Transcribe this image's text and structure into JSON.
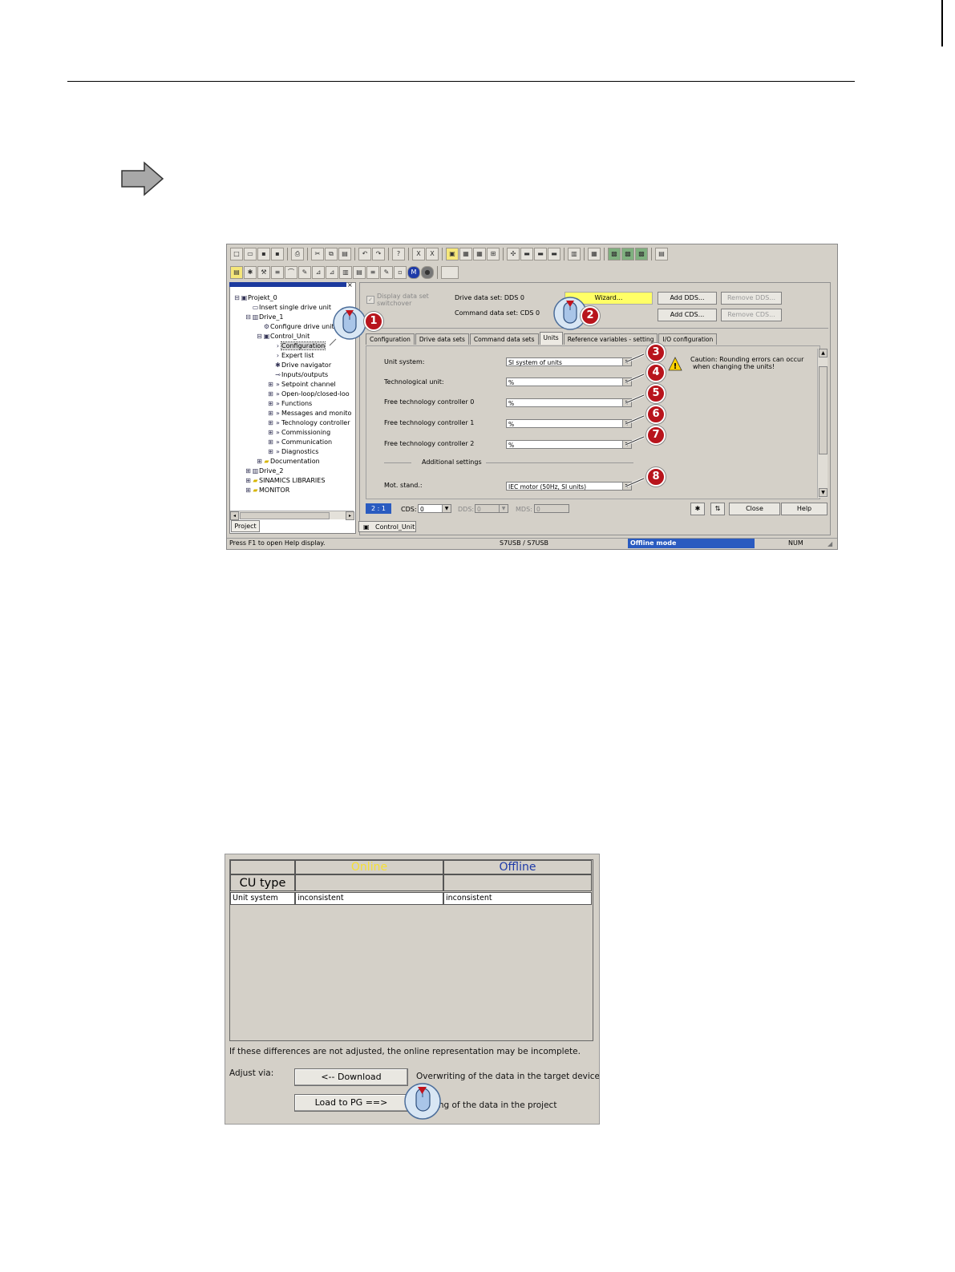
{
  "screenshot1": {
    "tree": {
      "items": [
        {
          "label": "Projekt_0",
          "indent": 0,
          "icon": "project-icon",
          "expander": "⊟"
        },
        {
          "label": "Insert single drive unit",
          "indent": 1,
          "icon": "insert-icon",
          "expander": ""
        },
        {
          "label": "Drive_1",
          "indent": 1,
          "icon": "drive-icon",
          "expander": "⊟"
        },
        {
          "label": "Configure drive unit",
          "indent": 2,
          "icon": "configure-icon",
          "expander": ""
        },
        {
          "label": "Control_Unit",
          "indent": 2,
          "icon": "control-unit-icon",
          "expander": "⊟"
        },
        {
          "label": "Configuration",
          "indent": 3,
          "icon": "arrow-icon",
          "expander": "",
          "selected": true
        },
        {
          "label": "Expert list",
          "indent": 3,
          "icon": "arrow-icon",
          "expander": ""
        },
        {
          "label": "Drive navigator",
          "indent": 3,
          "icon": "navigator-icon",
          "expander": ""
        },
        {
          "label": "Inputs/outputs",
          "indent": 3,
          "icon": "io-icon",
          "expander": ""
        },
        {
          "label": "Setpoint channel",
          "indent": 3,
          "icon": "double-arrow-icon",
          "expander": "⊞"
        },
        {
          "label": "Open-loop/closed-loo",
          "indent": 3,
          "icon": "double-arrow-icon",
          "expander": "⊞"
        },
        {
          "label": "Functions",
          "indent": 3,
          "icon": "double-arrow-icon",
          "expander": "⊞"
        },
        {
          "label": "Messages and monito",
          "indent": 3,
          "icon": "double-arrow-icon",
          "expander": "⊞"
        },
        {
          "label": "Technology controller",
          "indent": 3,
          "icon": "double-arrow-icon",
          "expander": "⊞"
        },
        {
          "label": "Commissioning",
          "indent": 3,
          "icon": "double-arrow-icon",
          "expander": "⊞"
        },
        {
          "label": "Communication",
          "indent": 3,
          "icon": "double-arrow-icon",
          "expander": "⊞"
        },
        {
          "label": "Diagnostics",
          "indent": 3,
          "icon": "double-arrow-icon",
          "expander": "⊞"
        },
        {
          "label": "Documentation",
          "indent": 2,
          "icon": "folder-icon",
          "expander": "⊞"
        },
        {
          "label": "Drive_2",
          "indent": 1,
          "icon": "drive-icon",
          "expander": "⊞"
        },
        {
          "label": "SINAMICS LIBRARIES",
          "indent": 1,
          "icon": "folder-icon",
          "expander": "⊞"
        },
        {
          "label": "MONITOR",
          "indent": 1,
          "icon": "folder-icon",
          "expander": "⊞"
        }
      ],
      "project_tab": "Project"
    },
    "header": {
      "display_dataset_label": "Display data set",
      "display_dataset_label2": "switchover",
      "drive_data_set": "Drive data set: DDS 0",
      "command_data_set": "Command data set: CDS 0",
      "wizard": "Wizard...",
      "add_dds": "Add DDS...",
      "remove_dds": "Remove DDS...",
      "add_cds": "Add CDS...",
      "remove_cds": "Remove CDS..."
    },
    "tabs": [
      "Configuration",
      "Drive data sets",
      "Command data sets",
      "Units",
      "Reference variables - setting",
      "I/O configuration"
    ],
    "form": {
      "unit_system": {
        "label": "Unit system:",
        "value": "SI system of units"
      },
      "technological_unit": {
        "label": "Technological unit:",
        "value": "%"
      },
      "ftc0": {
        "label": "Free technology controller 0",
        "value": "%"
      },
      "ftc1": {
        "label": "Free technology controller 1",
        "value": "%"
      },
      "ftc2": {
        "label": "Free technology controller 2",
        "value": "%"
      },
      "additional_settings": "Additional settings",
      "mot_stand": {
        "label": "Mot. stand.:",
        "value": "IEC motor (50Hz, SI units)"
      },
      "caution_line1": "Caution: Rounding errors can occur",
      "caution_line2": "when changing the units!"
    },
    "bottom": {
      "ratio": "2 : 1",
      "cds_label": "CDS:",
      "cds_value": "0",
      "dds_label": "DDS:",
      "dds_value": "0",
      "mds_label": "MDS:",
      "mds_value": "0",
      "close": "Close",
      "help": "Help",
      "doc_tab": "Control_Unit"
    },
    "status": {
      "help_text": "Press F1 to open Help display.",
      "connection": "S7USB / S7USB",
      "mode": "Offline mode",
      "num": "NUM"
    },
    "badges": [
      "1",
      "2",
      "3",
      "4",
      "5",
      "6",
      "7",
      "8"
    ],
    "colors": {
      "offline_bar": "#2a5bc0",
      "wizard": "#ffff66",
      "badge": "#b8141c"
    }
  },
  "screenshot2": {
    "col_online": "Online",
    "col_offline": "Offline",
    "row_header": "CU type",
    "rows": [
      {
        "name": "Unit system",
        "online": "inconsistent",
        "offline": "inconsistent"
      }
    ],
    "note": "If these differences are not adjusted, the online representation may be incomplete.",
    "adjust_via": "Adjust via:",
    "download_button": "<-- Download",
    "download_desc": "Overwriting of the data in the target device",
    "load_button": "Load to PG ==>",
    "load_desc": "...ling of the data in the project",
    "colors": {
      "online": "#f7e032",
      "offline": "#1f3ba8"
    }
  }
}
